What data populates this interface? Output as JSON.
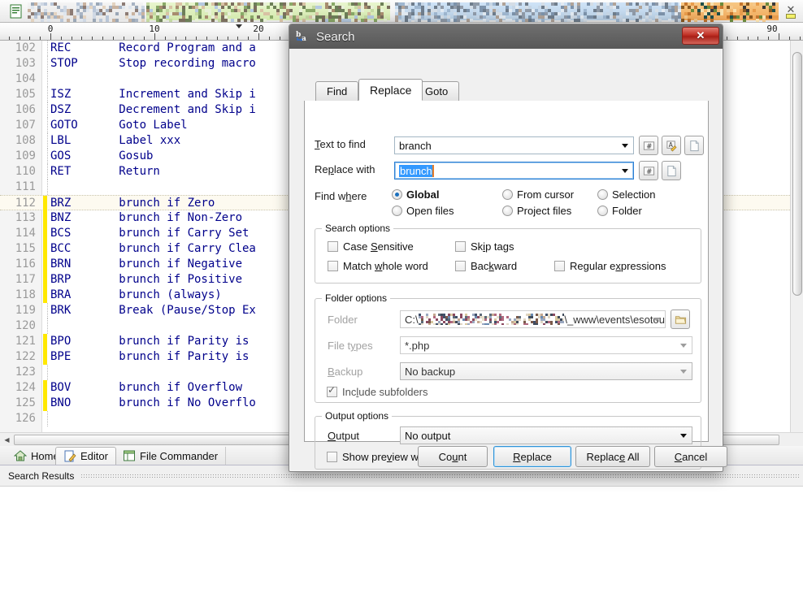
{
  "window": {
    "title": "Search",
    "title_icon": "replace-ba-icon",
    "close_label": "✕"
  },
  "toolbar": {
    "document_icon": "document-icon",
    "note": "redacted-toolbar"
  },
  "ruler": {
    "numbers": [
      "0",
      "10",
      "20",
      "90"
    ],
    "positions": [
      62,
      190,
      318,
      950
    ]
  },
  "editor": {
    "lines": [
      {
        "num": "102",
        "mnemonic": "REC",
        "desc": "Record Program and a",
        "modified": false,
        "current": false
      },
      {
        "num": "103",
        "mnemonic": "STOP",
        "desc": "Stop recording macro",
        "modified": false,
        "current": false
      },
      {
        "num": "104",
        "mnemonic": "",
        "desc": "",
        "modified": false,
        "current": false
      },
      {
        "num": "105",
        "mnemonic": "ISZ",
        "desc": "Increment and Skip i",
        "modified": false,
        "current": false
      },
      {
        "num": "106",
        "mnemonic": "DSZ",
        "desc": "Decrement and Skip i",
        "modified": false,
        "current": false
      },
      {
        "num": "107",
        "mnemonic": "GOTO",
        "desc": "Goto Label",
        "modified": false,
        "current": false
      },
      {
        "num": "108",
        "mnemonic": "LBL",
        "desc": "Label xxx",
        "modified": false,
        "current": false
      },
      {
        "num": "109",
        "mnemonic": "GOS",
        "desc": "Gosub",
        "modified": false,
        "current": false
      },
      {
        "num": "110",
        "mnemonic": "RET",
        "desc": "Return",
        "modified": false,
        "current": false
      },
      {
        "num": "111",
        "mnemonic": "",
        "desc": "",
        "modified": false,
        "current": false
      },
      {
        "num": "112",
        "mnemonic": "BRZ",
        "desc": "brunch if Zero",
        "modified": true,
        "current": true
      },
      {
        "num": "113",
        "mnemonic": "BNZ",
        "desc": "brunch if Non-Zero",
        "modified": true,
        "current": false
      },
      {
        "num": "114",
        "mnemonic": "BCS",
        "desc": "brunch if Carry Set",
        "modified": true,
        "current": false
      },
      {
        "num": "115",
        "mnemonic": "BCC",
        "desc": "brunch if Carry Clea",
        "modified": true,
        "current": false
      },
      {
        "num": "116",
        "mnemonic": "BRN",
        "desc": "brunch if Negative",
        "modified": true,
        "current": false
      },
      {
        "num": "117",
        "mnemonic": "BRP",
        "desc": "brunch if Positive",
        "modified": true,
        "current": false
      },
      {
        "num": "118",
        "mnemonic": "BRA",
        "desc": "brunch (always)",
        "modified": true,
        "current": false
      },
      {
        "num": "119",
        "mnemonic": "BRK",
        "desc": "Break (Pause/Stop Ex",
        "modified": false,
        "current": false
      },
      {
        "num": "120",
        "mnemonic": "",
        "desc": "",
        "modified": false,
        "current": false
      },
      {
        "num": "121",
        "mnemonic": "BPO",
        "desc": "brunch if Parity is",
        "modified": true,
        "current": false
      },
      {
        "num": "122",
        "mnemonic": "BPE",
        "desc": "brunch if Parity is",
        "modified": true,
        "current": false
      },
      {
        "num": "123",
        "mnemonic": "",
        "desc": "",
        "modified": false,
        "current": false
      },
      {
        "num": "124",
        "mnemonic": "BOV",
        "desc": "brunch if Overflow",
        "modified": true,
        "current": false
      },
      {
        "num": "125",
        "mnemonic": "BNO",
        "desc": "brunch if No Overflo",
        "modified": true,
        "current": false
      },
      {
        "num": "126",
        "mnemonic": "",
        "desc": "",
        "modified": false,
        "current": false
      }
    ],
    "text_color": "#00008b",
    "modified_marker_color": "#ffe800",
    "current_line_color": "#fdfaf0"
  },
  "bottom_tabs": [
    {
      "label": "Home",
      "icon": "home-icon",
      "active": false
    },
    {
      "label": "Editor",
      "icon": "editor-pencil-icon",
      "active": true
    },
    {
      "label": "File Commander",
      "icon": "file-commander-icon",
      "active": false
    }
  ],
  "status": {
    "search_results_label": "Search Results"
  },
  "dialog": {
    "tabs": [
      {
        "label": "Find",
        "active": false
      },
      {
        "label": "Replace",
        "active": true
      },
      {
        "label": "Goto",
        "active": false
      }
    ],
    "text_to_find": {
      "label": "Text to find",
      "label_accel": "T",
      "value": "branch",
      "buttons": [
        {
          "name": "insert-special-char-button",
          "icon": "hash-icon"
        },
        {
          "name": "insert-regex-button",
          "icon": "a-pencil-icon"
        },
        {
          "name": "paste-from-file-button",
          "icon": "page-icon"
        }
      ]
    },
    "replace_with": {
      "label": "Replace with",
      "label_accel": "p",
      "value": "brunch",
      "selected": true,
      "buttons": [
        {
          "name": "insert-special-char-button",
          "icon": "hash-icon"
        },
        {
          "name": "paste-from-file-button",
          "icon": "page-icon"
        }
      ]
    },
    "find_where": {
      "label": "Find where",
      "label_accel": "h",
      "options": [
        {
          "label": "Global",
          "selected": true
        },
        {
          "label": "From cursor",
          "selected": false
        },
        {
          "label": "Selection",
          "selected": false
        },
        {
          "label": "Open files",
          "selected": false
        },
        {
          "label": "Project files",
          "selected": false
        },
        {
          "label": "Folder",
          "selected": false
        }
      ]
    },
    "search_options": {
      "title": "Search options",
      "items": [
        {
          "label": "Case Sensitive",
          "checked": false,
          "col": 0,
          "row": 0
        },
        {
          "label": "Skip tags",
          "checked": false,
          "col": 1,
          "row": 0
        },
        {
          "label": "Match whole word",
          "checked": false,
          "col": 0,
          "row": 1
        },
        {
          "label": "Backward",
          "checked": false,
          "col": 1,
          "row": 1
        },
        {
          "label": "Regular expressions",
          "checked": false,
          "col": 2,
          "row": 1
        }
      ]
    },
    "folder_options": {
      "title": "Folder options",
      "folder_label": "Folder",
      "folder_value_prefix": "C:\\",
      "folder_value_suffix": "\\_www\\events\\esotou",
      "folder_redacted": true,
      "browse_button": "folder-browse-button",
      "file_types_label": "File types",
      "file_types_value": "*.php",
      "backup_label": "Backup",
      "backup_value": "No backup",
      "include_subfolders_label": "Include subfolders",
      "include_subfolders_checked": true,
      "disabled": true
    },
    "output_options": {
      "title": "Output options",
      "output_label": "Output",
      "output_value": "No output",
      "show_preview_label": "Show preview window",
      "show_preview_checked": false
    },
    "buttons": [
      {
        "label": "Count",
        "accel": "u",
        "default": false
      },
      {
        "label": "Replace",
        "accel": "R",
        "default": true
      },
      {
        "label": "Replace All",
        "accel": "e",
        "default": false
      },
      {
        "label": "Cancel",
        "accel": "C",
        "default": false
      }
    ]
  },
  "colors": {
    "accent_blue": "#2f93d8",
    "selection_blue": "#3399ff",
    "caret_orange": "#e87d2a",
    "code_blue": "#00008b",
    "modified_yellow": "#ffe800",
    "close_red": "#c03126"
  }
}
